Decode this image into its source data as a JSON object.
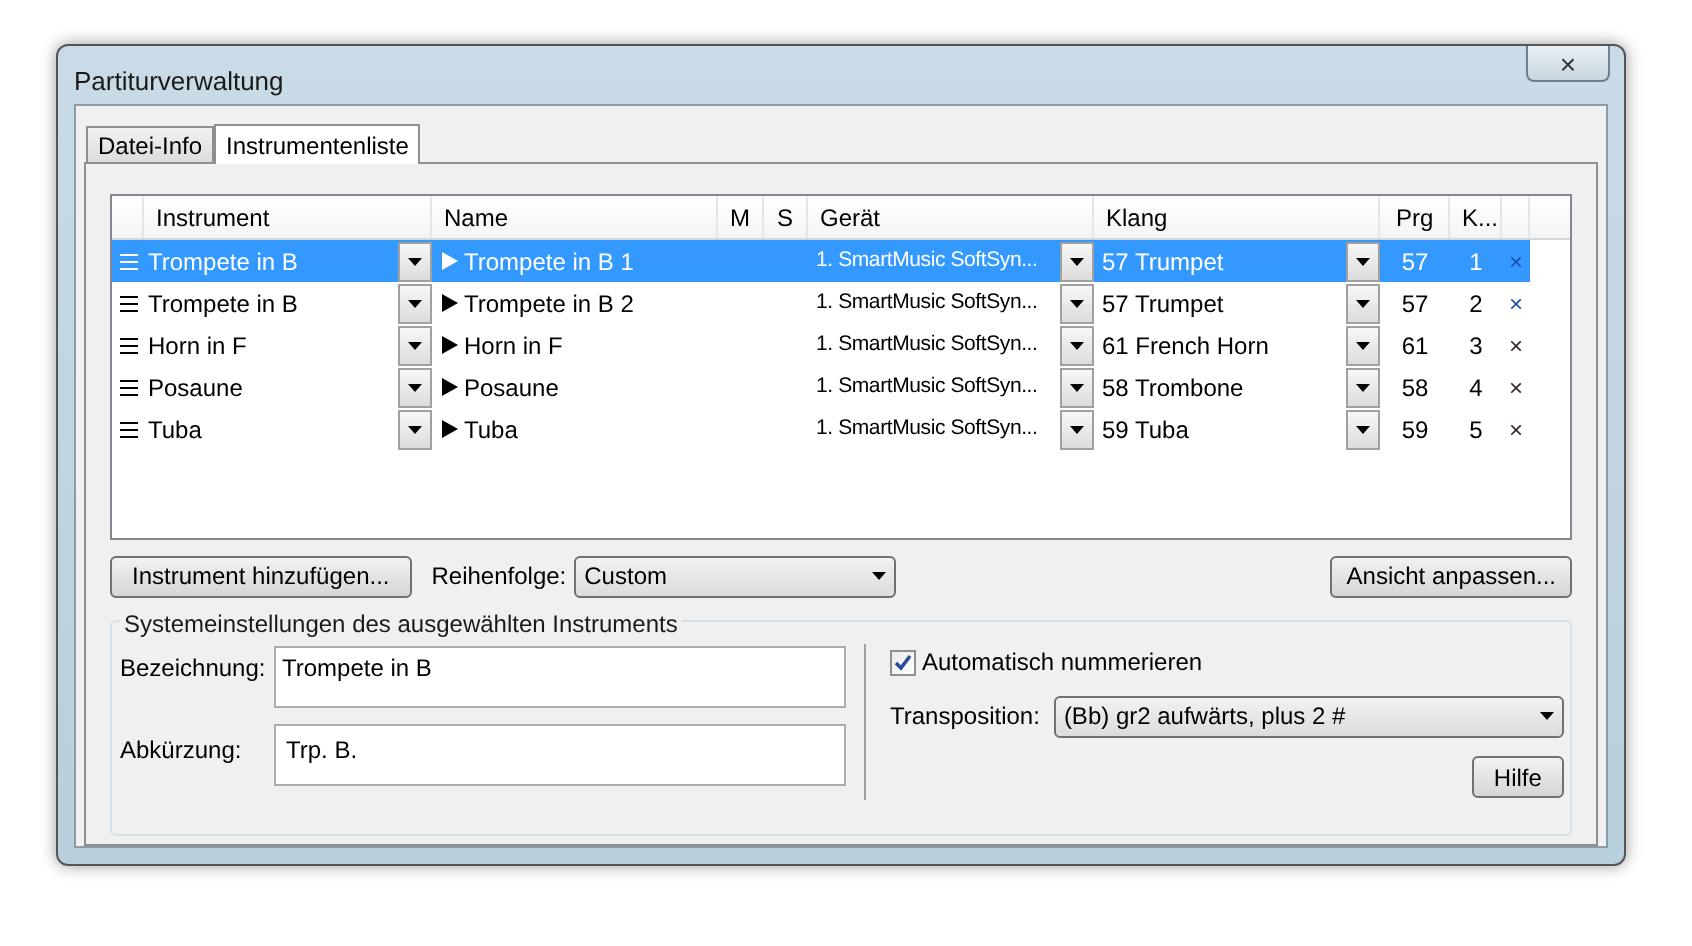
{
  "window": {
    "title": "Partiturverwaltung",
    "close": "×"
  },
  "tabs": [
    {
      "label": "Datei-Info",
      "selected": false
    },
    {
      "label": "Instrumentenliste",
      "selected": true
    }
  ],
  "table": {
    "columns": [
      "Instrument",
      "Name",
      "M",
      "S",
      "Gerät",
      "Klang",
      "Prg",
      "K..."
    ],
    "rows": [
      {
        "selected": true,
        "instrument": "Trompete in B",
        "name": "Trompete in B 1",
        "device": "1. SmartMusic SoftSyn...",
        "sound": "57 Trumpet",
        "prg": "57",
        "k": "1",
        "remove": "×",
        "color": "#1f4fb4"
      },
      {
        "selected": false,
        "instrument": "Trompete in B",
        "name": "Trompete in B 2",
        "device": "1. SmartMusic SoftSyn...",
        "sound": "57 Trumpet",
        "prg": "57",
        "k": "2",
        "remove": "×",
        "color": "#1f4fb4"
      },
      {
        "selected": false,
        "instrument": "Horn in F",
        "name": "Horn in F",
        "device": "1. SmartMusic SoftSyn...",
        "sound": "61 French Horn",
        "prg": "61",
        "k": "3",
        "remove": "×",
        "color": "#3a2a2a"
      },
      {
        "selected": false,
        "instrument": "Posaune",
        "name": "Posaune",
        "device": "1. SmartMusic SoftSyn...",
        "sound": "58 Trombone",
        "prg": "58",
        "k": "4",
        "remove": "×",
        "color": "#3a2a2a"
      },
      {
        "selected": false,
        "instrument": "Tuba",
        "name": "Tuba",
        "device": "1. SmartMusic SoftSyn...",
        "sound": "59 Tuba",
        "prg": "59",
        "k": "5",
        "remove": "×",
        "color": "#3a2a2a"
      }
    ]
  },
  "add_button": "Instrument hinzufügen...",
  "order": {
    "label": "Reihenfolge:",
    "value": "Custom"
  },
  "view_button": "Ansicht anpassen...",
  "group": {
    "title": "Systemeinstellungen des ausgewählten Instruments",
    "designation": {
      "label": "Bezeichnung:",
      "value": "Trompete in B"
    },
    "abbreviation": {
      "label": "Abkürzung:",
      "value": "Trp. B."
    },
    "auto_number": {
      "label": "Automatisch nummerieren",
      "checked": true
    },
    "transposition": {
      "label": "Transposition:",
      "value": "(Bb) gr2 aufwärts, plus 2 #"
    },
    "help_button": "Hilfe"
  }
}
